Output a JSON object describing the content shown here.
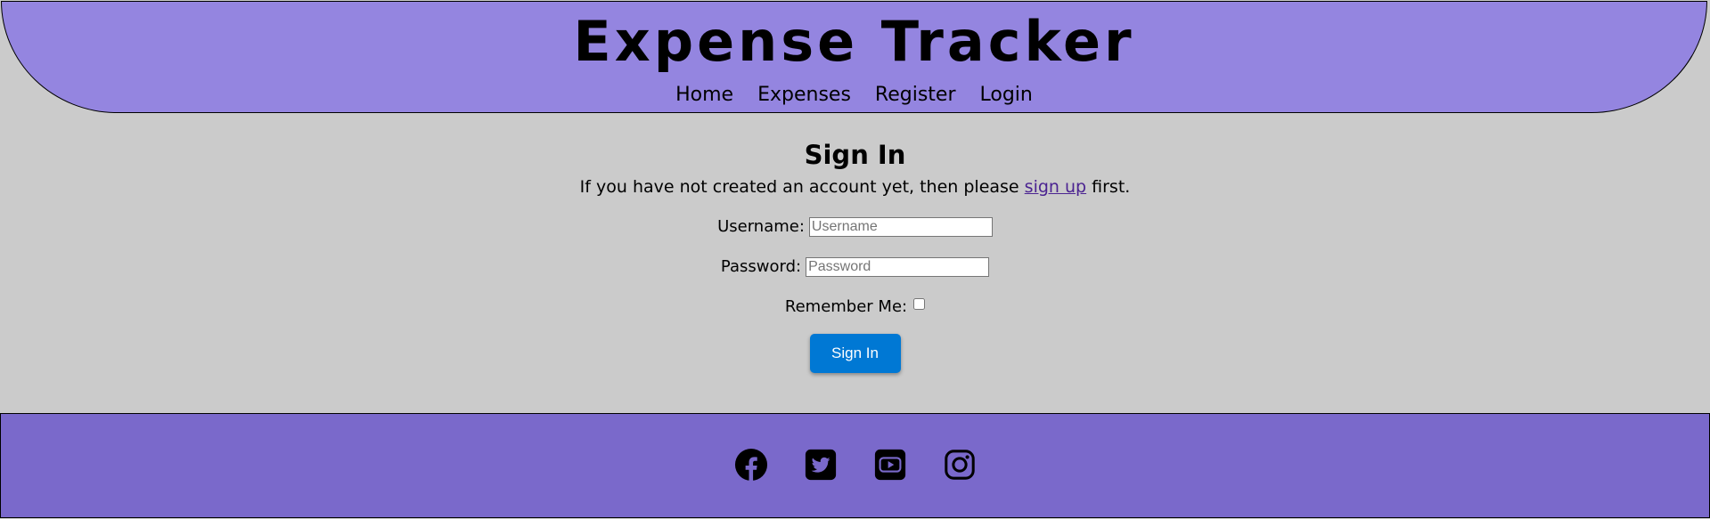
{
  "header": {
    "title": "Expense Tracker",
    "nav": [
      {
        "label": "Home"
      },
      {
        "label": "Expenses"
      },
      {
        "label": "Register"
      },
      {
        "label": "Login"
      }
    ]
  },
  "main": {
    "heading": "Sign In",
    "intro_before": "If you have not created an account yet, then please ",
    "intro_link": "sign up",
    "intro_after": " first.",
    "form": {
      "username_label": "Username:",
      "username_placeholder": "Username",
      "password_label": "Password:",
      "password_placeholder": "Password",
      "remember_label": "Remember Me:",
      "submit_label": "Sign In"
    }
  },
  "footer": {
    "social_icons": [
      "facebook-icon",
      "twitter-icon",
      "youtube-icon",
      "instagram-icon"
    ]
  },
  "colors": {
    "page_background": "#cbcbcb",
    "header_background": "#9485e0",
    "footer_background": "#7a69cb",
    "button": "#0078d4",
    "link": "#4b2391"
  }
}
